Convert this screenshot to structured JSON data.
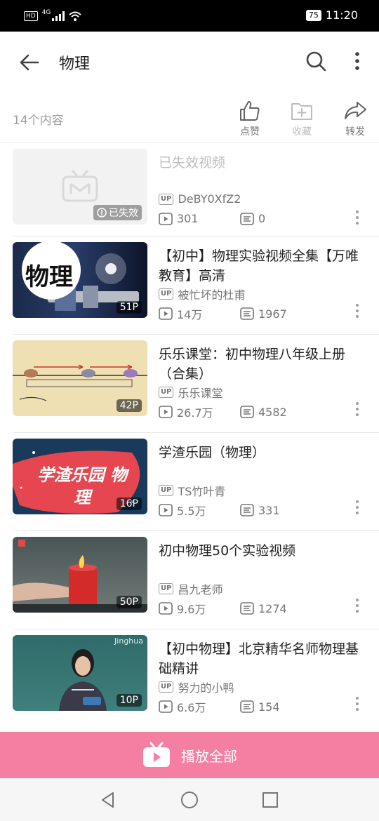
{
  "status_bar": {
    "network": "4G",
    "hd": "HD",
    "battery": "75",
    "time": "11:20"
  },
  "header": {
    "title": "物理",
    "back_icon": "arrow-left-icon",
    "search_icon": "search-icon",
    "more_icon": "more-vertical-icon"
  },
  "meta": {
    "count_label": "14个内容",
    "actions": [
      {
        "label": "点赞",
        "icon": "thumbs-up-icon"
      },
      {
        "label": "收藏",
        "icon": "folder-add-icon"
      },
      {
        "label": "转发",
        "icon": "share-icon"
      }
    ]
  },
  "videos": [
    {
      "title": "已失效视频",
      "uploader": "DeBY0XfZ2",
      "views": "301",
      "danmaku": "0",
      "badge": "已失效",
      "invalid": true
    },
    {
      "title": "【初中】物理实验视频全集【万唯教育】高清",
      "uploader": "被忙坏的杜甫",
      "views": "14万",
      "danmaku": "1967",
      "badge": "51P",
      "thumb_text": "物理"
    },
    {
      "title": "乐乐课堂：初中物理八年级上册（合集）",
      "uploader": "乐乐课堂",
      "views": "26.7万",
      "danmaku": "4582",
      "badge": "42P"
    },
    {
      "title": "学渣乐园（物理）",
      "uploader": "TS竹叶青",
      "views": "5.5万",
      "danmaku": "331",
      "badge": "16P",
      "thumb_text": "学渣乐园 物理"
    },
    {
      "title": "初中物理50个实验视频",
      "uploader": "昌九老师",
      "views": "9.6万",
      "danmaku": "1274",
      "badge": "50P"
    },
    {
      "title": "【初中物理】北京精华名师物理基础精讲",
      "uploader": "努力的小鸭",
      "views": "6.6万",
      "danmaku": "154",
      "badge": "10P",
      "thumb_text": "Jinghua"
    }
  ],
  "up_badge": "UP",
  "play_all": {
    "label": "播放全部",
    "icon": "tv-play-icon"
  },
  "colors": {
    "accent": "#f47fa3",
    "text": "#212121",
    "secondary": "#757575",
    "muted": "#bdbdbd"
  }
}
